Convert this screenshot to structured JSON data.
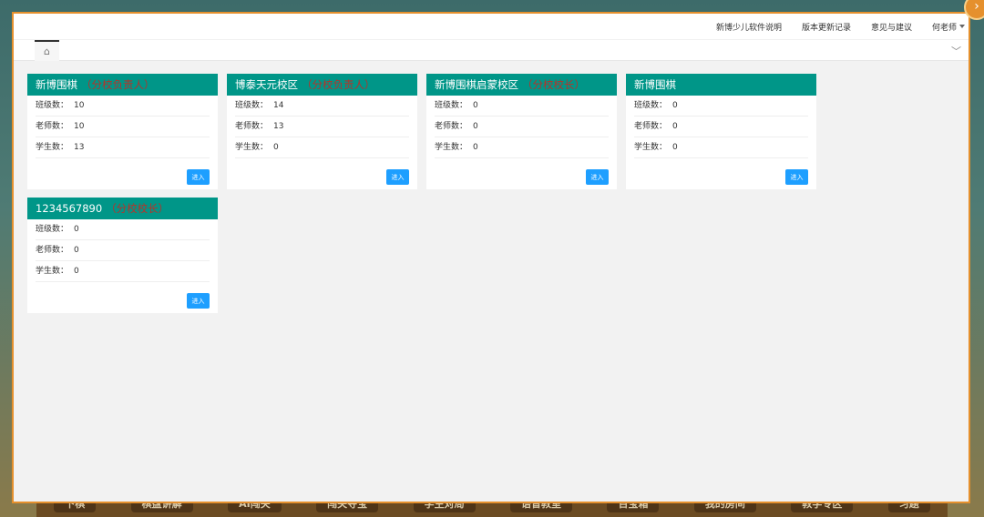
{
  "topbar": {
    "links": [
      "新博少儿软件说明",
      "版本更新记录",
      "意见与建议"
    ],
    "user": "何老师"
  },
  "tabs": {
    "home_icon": "⌂",
    "more_icon": "﹀"
  },
  "labels": {
    "classes": "班级数：",
    "teachers": "老师数：",
    "students": "学生数：",
    "enter": "进入"
  },
  "schools": [
    {
      "name": "新博围棋",
      "role": "（分校负责人）",
      "classes": "10",
      "teachers": "10",
      "students": "13"
    },
    {
      "name": "博泰天元校区",
      "role": "（分校负责人）",
      "classes": "14",
      "teachers": "13",
      "students": "0"
    },
    {
      "name": "新博围棋启蒙校区",
      "role": "（分校校长）",
      "classes": "0",
      "teachers": "0",
      "students": "0"
    },
    {
      "name": "新博围棋",
      "role": "",
      "classes": "0",
      "teachers": "0",
      "students": "0"
    },
    {
      "name": "1234567890",
      "role": "（分校校长）",
      "classes": "0",
      "teachers": "0",
      "students": "0"
    }
  ],
  "bottom_nav": [
    "下棋",
    "棋盘讲解",
    "AI闯关",
    "闯关夺宝",
    "学生对局",
    "语音教室",
    "百宝箱",
    "我的房间",
    "教学专区",
    "习题"
  ],
  "colors": {
    "header": "#009688",
    "button": "#1e9fff",
    "border": "#e5902d"
  }
}
